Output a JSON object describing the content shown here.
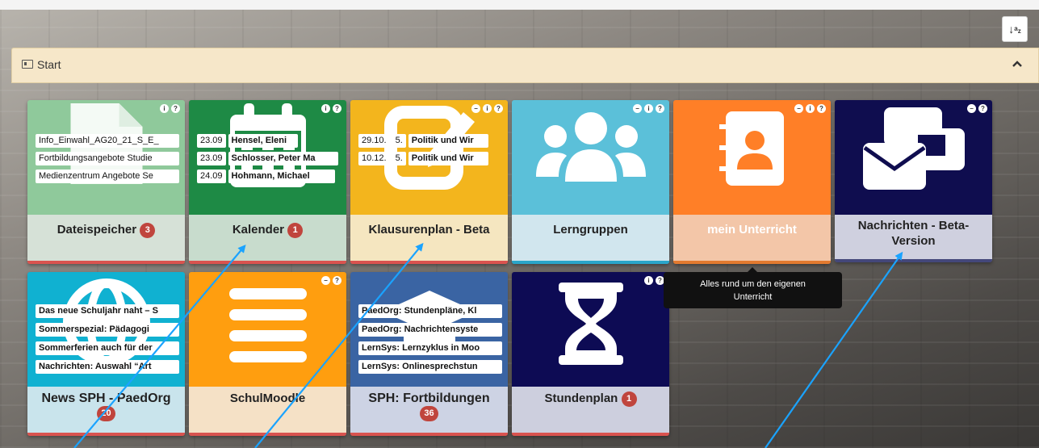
{
  "toolbar": {
    "sort_icon": "sort-az-icon",
    "sort_label": "↓ᵃᶻ"
  },
  "panel": {
    "title": "Start",
    "icon": "newspaper-icon",
    "collapse_icon": "chevron-up-icon",
    "collapse_glyph": "⌃"
  },
  "tiles": [
    {
      "id": "dateispeicher",
      "label": "Dateispeicher",
      "badge": "3",
      "colors": {
        "top": "#8fc99b",
        "bottom": "#d6e1d7",
        "bar": "#d9534f"
      },
      "icon": "file-icon",
      "items": [
        "Info_Einwahl_AG20_21_S_E_",
        "Fortbildungsangebote Studie",
        "Medienzentrum Angebote Se"
      ]
    },
    {
      "id": "kalender",
      "label": "Kalender",
      "badge": "1",
      "colors": {
        "top": "#1e8a45",
        "bottom": "#c8dccd",
        "bar": "#d9534f"
      },
      "icon": "calendar-icon",
      "rows": [
        {
          "date": "23.09",
          "name": "Hensel, Eleni"
        },
        {
          "date": "23.09",
          "name": "Schlosser, Peter Ma"
        },
        {
          "date": "24.09",
          "name": "Hohmann, Michael"
        }
      ]
    },
    {
      "id": "klausurenplan",
      "label": "Klausurenplan - Beta",
      "colors": {
        "top": "#f3b51d",
        "bottom": "#f5e6c0",
        "bar": "#d9534f"
      },
      "icon": "edit-icon",
      "rows": [
        {
          "date": "29.10.",
          "num": "5.",
          "subject": "Politik und Wir"
        },
        {
          "date": "10.12.",
          "num": "5.",
          "subject": "Politik und Wir"
        }
      ]
    },
    {
      "id": "lerngruppen",
      "label": "Lerngruppen",
      "colors": {
        "top": "#5bc0d9",
        "bottom": "#d1e6ee",
        "bar": "#2aa5c9"
      },
      "icon": "users-icon"
    },
    {
      "id": "mein-unterricht",
      "label": "mein Unterricht",
      "colors": {
        "top": "#ff7f27",
        "bottom": "#f3c6a8",
        "bar": "#e27a2f"
      },
      "icon": "address-book-icon"
    },
    {
      "id": "nachrichten",
      "label": "Nachrichten - Beta-Version",
      "colors": {
        "top": "#0f0d4f",
        "bottom": "#cfd0df",
        "bar": "#44477a"
      },
      "icon": "messages-icon"
    },
    {
      "id": "news-sph",
      "label": "News SPH - PaedOrg",
      "badge": "20",
      "colors": {
        "top": "#10b1d1",
        "bottom": "#c9e4ec",
        "bar": "#d9534f"
      },
      "icon": "globe-icon",
      "items": [
        "Das neue Schuljahr naht – S",
        "Sommerspezial: Pädagogi",
        "Sommerferien auch für der",
        "Nachrichten: Auswahl “Art"
      ]
    },
    {
      "id": "schulmoodle",
      "label": "SchulMoodle",
      "colors": {
        "top": "#ff9e0f",
        "bottom": "#f5e1c6",
        "bar": "#d9534f"
      },
      "icon": "list-icon"
    },
    {
      "id": "sph-fortbildungen",
      "label": "SPH: Fortbildungen",
      "badge": "36",
      "colors": {
        "top": "#3a64a3",
        "bottom": "#cdd3e4",
        "bar": "#d9534f"
      },
      "icon": "graduation-icon",
      "items": [
        "PaedOrg: Stundenpläne, Kl",
        "PaedOrg: Nachrichtensyste",
        "LernSys: Lernzyklus in Moo",
        "LernSys: Onlinesprechstun"
      ]
    },
    {
      "id": "stundenplan",
      "label": "Stundenplan",
      "badge": "1",
      "colors": {
        "top": "#0d0b54",
        "bottom": "#cdcfde",
        "bar": "#d9534f"
      },
      "icon": "hourglass-icon"
    }
  ],
  "tooltip": {
    "text_line1": "Alles rund um den eigenen",
    "text_line2": "Unterricht"
  }
}
